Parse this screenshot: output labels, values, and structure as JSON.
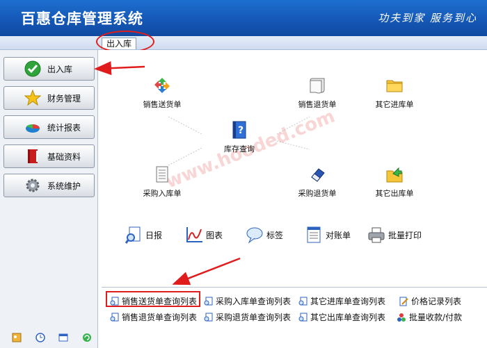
{
  "app": {
    "title": "百惠仓库管理系统",
    "slogan": "功夫到家 服务到心"
  },
  "tabs": [
    {
      "label": "出入库"
    }
  ],
  "sidebar": {
    "items": [
      {
        "label": "出入库",
        "icon": "check-icon"
      },
      {
        "label": "财务管理",
        "icon": "star-icon"
      },
      {
        "label": "统计报表",
        "icon": "pie-chart-icon"
      },
      {
        "label": "基础资料",
        "icon": "book-icon"
      },
      {
        "label": "系统维护",
        "icon": "gear-icon"
      }
    ],
    "footer_icons": [
      "key-icon",
      "clock-icon",
      "window-icon",
      "refresh-icon"
    ]
  },
  "flow": {
    "items": [
      {
        "label": "销售送货单",
        "icon": "recycle-icon"
      },
      {
        "label": "销售退货单",
        "icon": "scroll-icon"
      },
      {
        "label": "其它进库单",
        "icon": "folder-icon"
      },
      {
        "label": "库存查询",
        "icon": "help-book-icon"
      },
      {
        "label": "采购入库单",
        "icon": "document-icon"
      },
      {
        "label": "采购退货单",
        "icon": "eraser-icon"
      },
      {
        "label": "其它出库单",
        "icon": "folder-out-icon"
      }
    ]
  },
  "toolbar": {
    "items": [
      {
        "label": "日报",
        "icon": "magnifier-report-icon"
      },
      {
        "label": "图表",
        "icon": "line-chart-icon"
      },
      {
        "label": "标签",
        "icon": "speech-bubble-icon"
      },
      {
        "label": "对账单",
        "icon": "statement-icon"
      },
      {
        "label": "批量打印",
        "icon": "printer-icon"
      }
    ]
  },
  "lists": {
    "items": [
      {
        "label": "销售送货单查询列表",
        "icon": "magnifier-doc-icon"
      },
      {
        "label": "采购入库单查询列表",
        "icon": "magnifier-doc-icon"
      },
      {
        "label": "其它进库单查询列表",
        "icon": "magnifier-doc-icon"
      },
      {
        "label": "价格记录列表",
        "icon": "pencil-doc-icon"
      },
      {
        "label": "销售退货单查询列表",
        "icon": "magnifier-doc-icon"
      },
      {
        "label": "采购退货单查询列表",
        "icon": "magnifier-doc-icon"
      },
      {
        "label": "其它出库单查询列表",
        "icon": "magnifier-doc-icon"
      },
      {
        "label": "批量收款/付款",
        "icon": "colored-balls-icon"
      }
    ]
  },
  "watermark": "www.hooded.com",
  "colors": {
    "header": "#1558b6",
    "highlight": "#e01c1c",
    "sidebar_bg": "#eef1f5"
  }
}
